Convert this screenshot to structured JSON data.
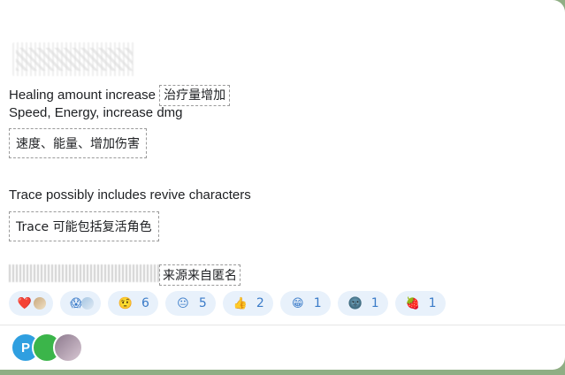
{
  "message": {
    "line1_en": "Healing amount increase",
    "line1_cn": "治疗量增加",
    "line2_en": "Speed, Energy, increase dmg",
    "box1_cn": "速度、能量、增加伤害",
    "line3_en": "Trace possibly includes revive characters",
    "box2_text": "Trace 可能包括复活角色",
    "source_cn": "来源来自匿名"
  },
  "reactions": [
    {
      "emoji": "❤️",
      "icon": "heart-icon",
      "count": ""
    },
    {
      "emoji": "😱",
      "icon": "scream-face-icon",
      "count": ""
    },
    {
      "emoji": "🤨",
      "icon": "raised-eyebrow-face-icon",
      "count": "6"
    },
    {
      "emoji": "😐",
      "icon": "neutral-face-icon",
      "count": "5"
    },
    {
      "emoji": "👍",
      "icon": "thumbs-up-icon",
      "count": "2"
    },
    {
      "emoji": "😁",
      "icon": "grinning-face-icon",
      "count": "1"
    },
    {
      "emoji": "🌚",
      "icon": "new-moon-face-icon",
      "count": "1"
    },
    {
      "emoji": "🍓",
      "icon": "strawberry-icon",
      "count": "1"
    }
  ],
  "viewers": {
    "avatar1_letter": "P"
  },
  "colors": {
    "reaction_bg": "#e8f1fb",
    "reaction_text": "#3a7bc8",
    "app_bg": "#8fae84"
  }
}
